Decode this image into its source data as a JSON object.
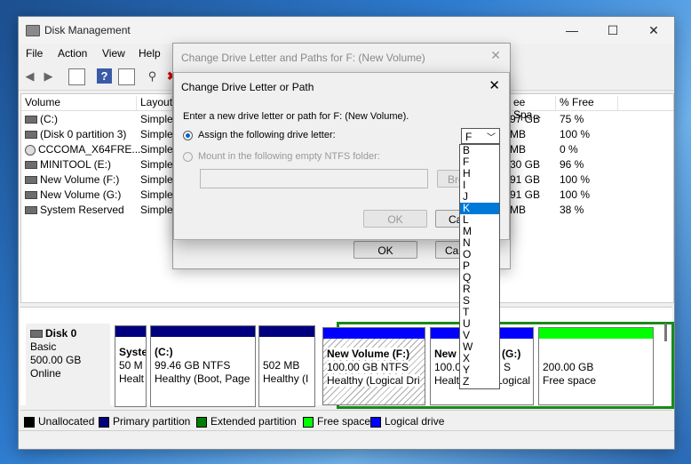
{
  "window": {
    "title": "Disk Management",
    "minimize": "—",
    "maximize": "☐",
    "close": "✕"
  },
  "menu": [
    "File",
    "Action",
    "View",
    "Help"
  ],
  "volume_list": {
    "headers": {
      "volume": "Volume",
      "layout": "Layout",
      "free_space": "ee Spa...",
      "pct_free": "% Free"
    },
    "rows": [
      {
        "icon": "drive",
        "name": "(C:)",
        "layout": "Simple",
        "free": "97 GB",
        "pct": "75 %"
      },
      {
        "icon": "drive",
        "name": "(Disk 0 partition 3)",
        "layout": "Simple",
        "free": "MB",
        "pct": "100 %"
      },
      {
        "icon": "cd",
        "name": "CCCOMA_X64FRE...",
        "layout": "Simple",
        "free": "MB",
        "pct": "0 %"
      },
      {
        "icon": "drive",
        "name": "MINITOOL (E:)",
        "layout": "Simple",
        "free": "30 GB",
        "pct": "96 %"
      },
      {
        "icon": "drive",
        "name": "New Volume (F:)",
        "layout": "Simple",
        "free": "91 GB",
        "pct": "100 %"
      },
      {
        "icon": "drive",
        "name": "New Volume (G:)",
        "layout": "Simple",
        "free": "91 GB",
        "pct": "100 %"
      },
      {
        "icon": "drive",
        "name": "System Reserved",
        "layout": "Simple",
        "free": "MB",
        "pct": "38 %"
      }
    ]
  },
  "disk0": {
    "name": "Disk 0",
    "type": "Basic",
    "size": "500.00 GB",
    "status": "Online"
  },
  "partitions": [
    {
      "l1": "Syste",
      "l2": "50 M",
      "l3": "Healt"
    },
    {
      "l1": "(C:)",
      "l2": "99.46 GB NTFS",
      "l3": "Healthy (Boot, Page"
    },
    {
      "l1": "",
      "l2": "502 MB",
      "l3": "Healthy (I"
    },
    {
      "l1": "New Volume  (F:)",
      "l2": "100.00 GB NTFS",
      "l3": "Healthy (Logical Dri"
    },
    {
      "l1": "New",
      "l2": "100.0",
      "l3": "Healt"
    },
    {
      "l1": "(G:)",
      "l2": "S",
      "l3": "Logical Driv"
    },
    {
      "l1": "",
      "l2": "200.00 GB",
      "l3": "Free space"
    }
  ],
  "legend": [
    {
      "label": "Unallocated",
      "color": "#000000"
    },
    {
      "label": "Primary partition",
      "color": "#00007f"
    },
    {
      "label": "Extended partition",
      "color": "#007f00"
    },
    {
      "label": "Free space",
      "color": "#00ff00"
    },
    {
      "label": "Logical drive",
      "color": "#0000ff"
    }
  ],
  "dialog_paths": {
    "title": "Change Drive Letter and Paths for F: (New Volume)",
    "ok": "OK",
    "cancel": "Can",
    "close": "✕"
  },
  "dialog_letter": {
    "title": "Change Drive Letter or Path",
    "close": "✕",
    "prompt": "Enter a new drive letter or path for F: (New Volume).",
    "assign_label": "Assign the following drive letter:",
    "mount_label": "Mount in the following empty NTFS folder:",
    "browse": "Bro",
    "ok": "OK",
    "cancel": "Ca",
    "selected_letter": "F",
    "letters": [
      "B",
      "F",
      "H",
      "I",
      "J",
      "K",
      "L",
      "M",
      "N",
      "O",
      "P",
      "Q",
      "R",
      "S",
      "T",
      "U",
      "V",
      "W",
      "X",
      "Y",
      "Z"
    ],
    "highlighted": "K"
  }
}
